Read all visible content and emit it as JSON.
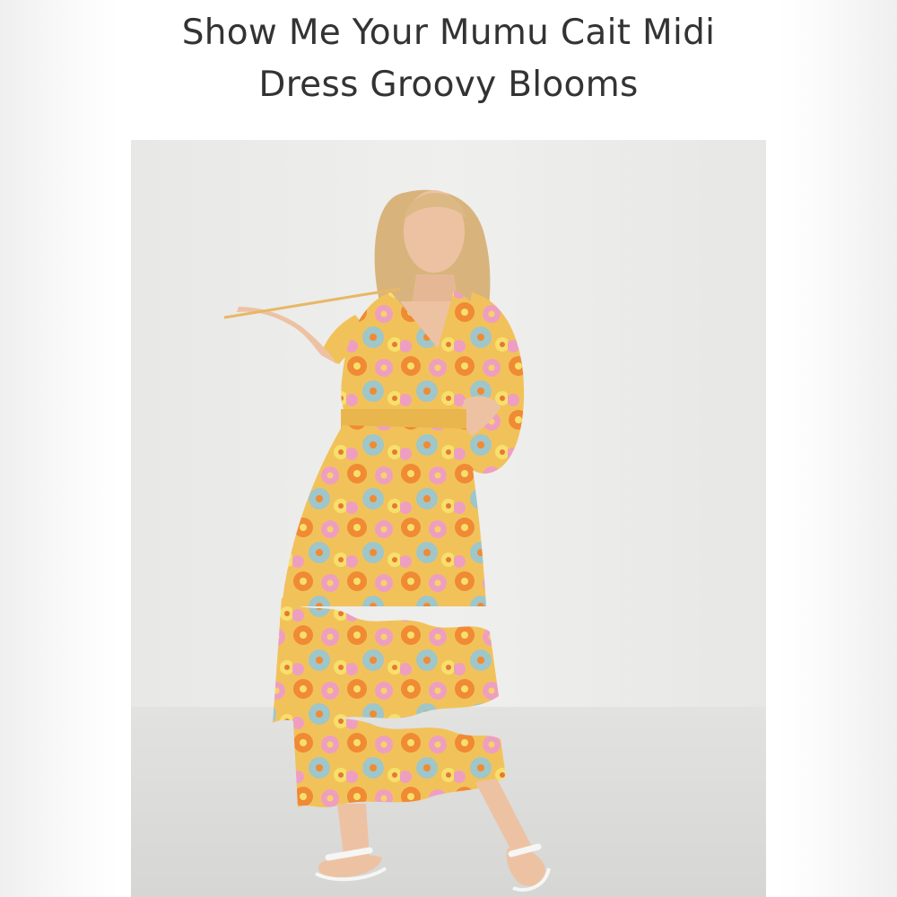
{
  "product": {
    "title_line1": "Show Me Your Mumu Cait Midi",
    "title_line2": "Dress Groovy Blooms"
  },
  "photo": {
    "subject": "model in floral midi dress",
    "palette": {
      "wall": "#ececea",
      "floor": "#dcdcda",
      "dress_base": "#f2c25a",
      "dress_orange": "#f08a34",
      "dress_pink": "#ee9fc0",
      "dress_blue": "#9fc6c9",
      "dress_yellow": "#f7e06a",
      "skin": "#edc2a3",
      "hair": "#d8b47c",
      "sandal": "#f6f6f4"
    }
  }
}
